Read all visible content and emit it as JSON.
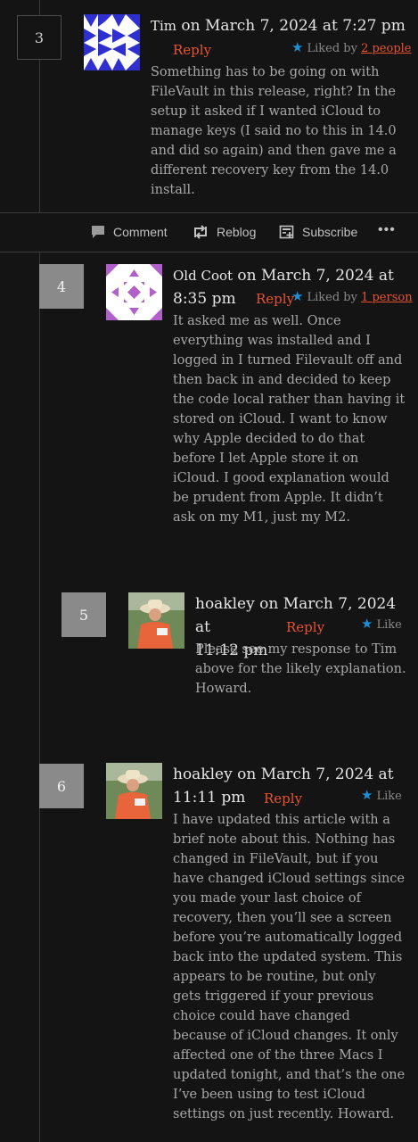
{
  "comments": [
    {
      "number": "3",
      "author": "Tim",
      "date": " on March 7, 2024 at 7:27 pm",
      "reply": "Reply",
      "likes_text": "Liked by ",
      "likes_link": "2 people",
      "body": "Something has to be going on with FileVault in this release, right? In the setup it asked if I wanted iCloud to manage keys (I said no to this in 14.0 and did so again) and then gave me a different recovery key from the 14.0 install."
    },
    {
      "number": "4",
      "author": "Old Coot",
      "date_line1": " on March 7, 2024 at",
      "date_line2": "8:35 pm",
      "reply": "Reply",
      "likes_text": "Liked by ",
      "likes_link": "1 person",
      "body": "It asked me as well. Once everything was installed and I logged in I turned Filevault off and then back in and decided to keep the code local rather than having it stored on iCloud. I want to know why Apple decided to do that before I let Apple store it on iCloud. I good explanation would be prudent from Apple. It didn’t ask on my M1, just my M2."
    },
    {
      "number": "5",
      "author": "hoakley",
      "date_line1": " on March 7, 2024 at",
      "date_line2": "11:12 pm",
      "reply": "Reply",
      "like": "Like",
      "body": "Please see my response to Tim above for the likely explanation. Howard."
    },
    {
      "number": "6",
      "author": "hoakley",
      "date_line1": " on March 7, 2024 at",
      "date_line2": "11:11 pm",
      "reply": "Reply",
      "like": "Like",
      "body": "I have updated this article with a brief note about this. Nothing has changed in FileVault, but if you have changed iCloud settings since you made your last choice of recovery, then you’ll see a screen before you’re automatically logged back into the updated system. This appears to be routine, but only gets triggered if your previous choice could have changed because of iCloud changes. It only affected one of the three Macs I updated tonight, and that’s the one I’ve been using to test iCloud settings on just recently. Howard."
    }
  ],
  "action_bar": {
    "comment": "Comment",
    "reblog": "Reblog",
    "subscribe": "Subscribe",
    "more": "•••"
  },
  "colors": {
    "background": "#141414",
    "link": "#e8532e",
    "star": "#1f8fd6",
    "text": "#a8a8a8"
  }
}
